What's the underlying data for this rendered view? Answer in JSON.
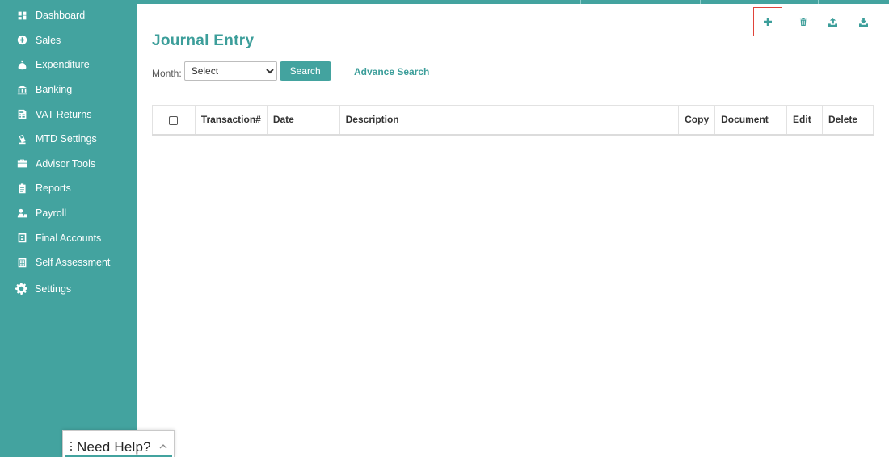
{
  "sidebar": {
    "items": [
      {
        "label": "Dashboard",
        "icon": "dashboard-icon"
      },
      {
        "label": "Sales",
        "icon": "sales-icon"
      },
      {
        "label": "Expenditure",
        "icon": "expenditure-icon"
      },
      {
        "label": "Banking",
        "icon": "bank-icon"
      },
      {
        "label": "VAT Returns",
        "icon": "vat-returns-icon"
      },
      {
        "label": "MTD Settings",
        "icon": "mtd-settings-icon"
      },
      {
        "label": "Advisor Tools",
        "icon": "briefcase-icon"
      },
      {
        "label": "Reports",
        "icon": "reports-icon"
      },
      {
        "label": "Payroll",
        "icon": "payroll-icon"
      },
      {
        "label": "Final Accounts",
        "icon": "final-accounts-icon"
      },
      {
        "label": "Self Assessment",
        "icon": "self-assessment-icon"
      },
      {
        "label": "Settings",
        "icon": "gear-icon"
      }
    ]
  },
  "help": {
    "label": "Need Help?"
  },
  "page": {
    "title": "Journal Entry"
  },
  "toolbar": {
    "add": "plus-icon",
    "delete": "trash-icon",
    "upload": "upload-icon",
    "download": "download-icon"
  },
  "filter": {
    "month_label": "Month:",
    "month_selected": "Select",
    "search_label": "Search",
    "advance_search_label": "Advance Search"
  },
  "table": {
    "columns": [
      "Transaction#",
      "Date",
      "Description",
      "Copy",
      "Document",
      "Edit",
      "Delete"
    ]
  },
  "colors": {
    "brand": "#43a39f",
    "accent_text": "#3c9e9a",
    "highlight_border": "#e0433a"
  }
}
